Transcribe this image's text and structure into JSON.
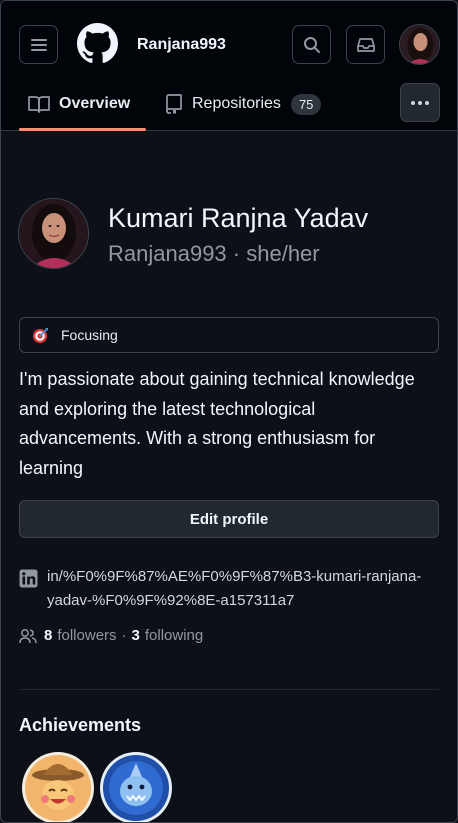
{
  "header": {
    "username": "Ranjana993",
    "icons": [
      "menu-icon",
      "github-logo",
      "search-icon",
      "inbox-icon",
      "avatar"
    ]
  },
  "tabs": [
    {
      "label": "Overview",
      "icon": "book-icon",
      "selected": true
    },
    {
      "label": "Repositories",
      "icon": "repo-icon",
      "count": "75"
    }
  ],
  "profile": {
    "full_name": "Kumari Ranjna Yadav",
    "login": "Ranjana993",
    "separator": " · ",
    "pronouns": "she/her",
    "status_emoji": "dart-icon",
    "status_text": "Focusing",
    "bio": "I'm passionate about gaining technical knowledge and exploring the latest technological advancements. With a strong enthusiasm for learning",
    "edit_label": "Edit profile",
    "social_link": "in/%F0%9F%87%AE%F0%9F%87%B3-kumari-ranjana-yadav-%F0%9F%92%8E-a157311a7",
    "followers_count": "8",
    "followers_label": "followers",
    "following_count": "3",
    "following_label": "following",
    "dot": "·"
  },
  "achievements": {
    "title": "Achievements",
    "badges": [
      "yolo-badge-icon",
      "pull-shark-badge-icon"
    ]
  },
  "colors": {
    "background": "#0d1117",
    "header": "#010409",
    "accent_underline": "#fd8c73",
    "border": "#3d444d",
    "muted": "#9198a1"
  }
}
